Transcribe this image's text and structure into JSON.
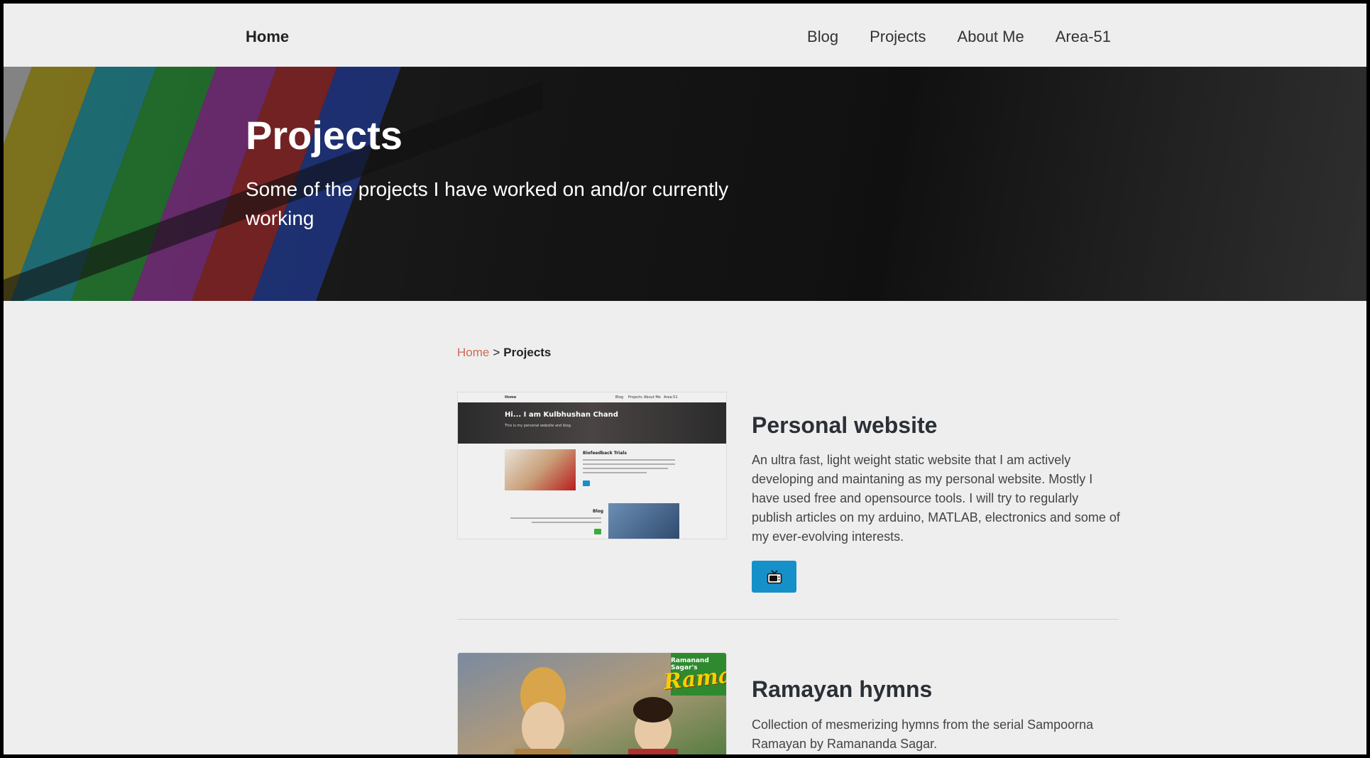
{
  "navbar": {
    "brand": "Home",
    "links": [
      "Blog",
      "Projects",
      "About Me",
      "Area-51"
    ]
  },
  "hero": {
    "title": "Projects",
    "subtitle": "Some of the projects I have worked on and/or currently working"
  },
  "breadcrumb": {
    "home": "Home",
    "separator": ">",
    "current": "Projects"
  },
  "projects": [
    {
      "title": "Personal website",
      "description": "An ultra fast, light weight static website that I am actively developing and maintaning as my personal website. Mostly I have used free and opensource tools. I will try to regularly publish articles on my arduino, MATLAB, electronics and some of my ever-evolving interests.",
      "button_icon": "tv-icon",
      "thumbnail": {
        "nav_brand": "Home",
        "nav_links": [
          "Blog",
          "Projects",
          "About Me",
          "Area-51"
        ],
        "hero_title": "Hi... I am Kulbhushan Chand",
        "hero_subtitle": "This is my personal website and blog.",
        "card1_title": "Biofeedback Trials",
        "card2_title": "Blog"
      }
    },
    {
      "title": "Ramayan hymns",
      "description": "Collection of mesmerizing hymns from the serial Sampoorna Ramayan by Ramananda Sagar.",
      "thumbnail": {
        "badge_top": "Ramanand Sagar's",
        "badge_main": "Ramayan"
      }
    }
  ],
  "colors": {
    "background": "#eeeeee",
    "accent_button": "#1690c8",
    "breadcrumb_link": "#d06a55"
  }
}
